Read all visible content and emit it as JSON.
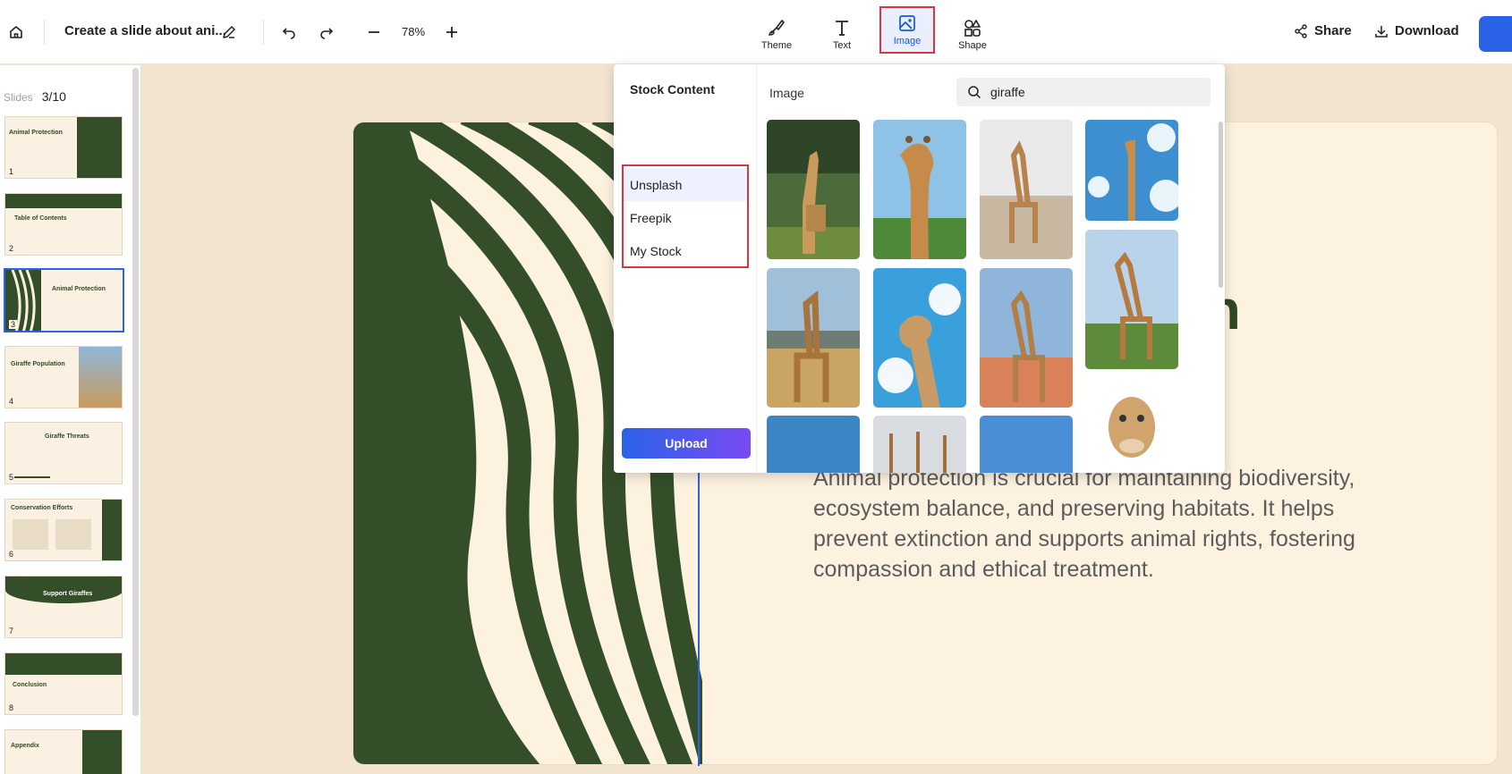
{
  "header": {
    "doc_title": "Create a slide about ani...",
    "zoom": "78%",
    "tools": {
      "theme": "Theme",
      "text": "Text",
      "image": "Image",
      "shape": "Shape"
    },
    "share": "Share",
    "download": "Download"
  },
  "sidebar": {
    "label": "Slides",
    "count": "3/10",
    "slides": [
      {
        "num": "1",
        "title": "Animal Protection"
      },
      {
        "num": "2",
        "title": "Table of Contents"
      },
      {
        "num": "3",
        "title": "Animal Protection"
      },
      {
        "num": "4",
        "title": "Giraffe Population"
      },
      {
        "num": "5",
        "title": "Giraffe Threats"
      },
      {
        "num": "6",
        "title": "Conservation Efforts"
      },
      {
        "num": "7",
        "title": "Support Giraffes"
      },
      {
        "num": "8",
        "title": "Conclusion"
      },
      {
        "num": "",
        "title": "Appendix"
      }
    ]
  },
  "slide": {
    "title_fragment": "on",
    "body": "Animal protection is crucial for maintaining biodiversity, ecosystem balance, and preserving habitats. It helps prevent extinction and supports animal rights, fostering compassion and ethical treatment."
  },
  "image_panel": {
    "heading": "Stock Content",
    "sources": [
      "Unsplash",
      "Freepik",
      "My Stock"
    ],
    "upload": "Upload",
    "tab_label": "Image",
    "search_value": "giraffe"
  },
  "colors": {
    "accent": "#2b63e8",
    "brand_green": "#344e2a",
    "highlight": "#d9363e",
    "cream": "#fdf1e0"
  }
}
